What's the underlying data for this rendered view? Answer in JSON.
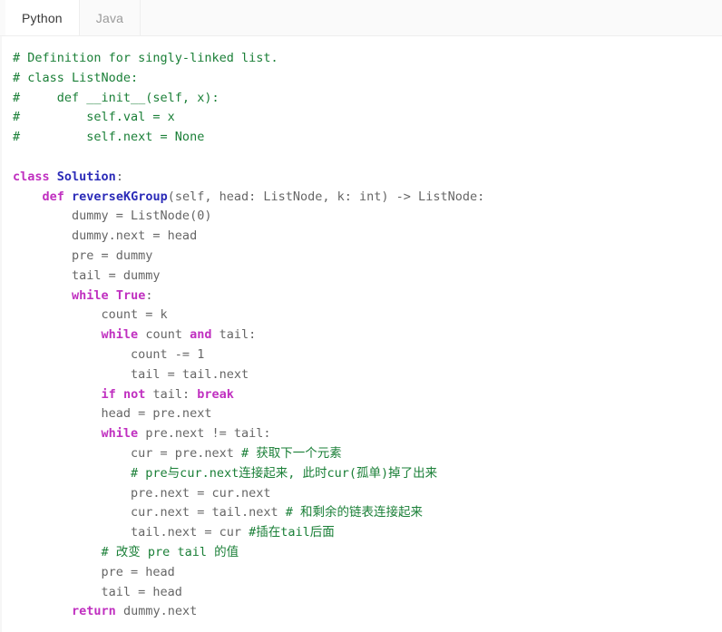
{
  "tabs": [
    {
      "label": "Python",
      "active": true
    },
    {
      "label": "Java",
      "active": false
    }
  ],
  "colors": {
    "comment": "#1a7f37",
    "keyword": "#c030c0",
    "name": "#2b2bb8",
    "plain": "#666666",
    "background": "#ffffff",
    "tabbar_background": "#fafafa",
    "border": "#eeeeee"
  },
  "code": {
    "language": "Python",
    "lines": [
      [
        {
          "t": "comment",
          "s": "# Definition for singly-linked list."
        }
      ],
      [
        {
          "t": "comment",
          "s": "# class ListNode:"
        }
      ],
      [
        {
          "t": "comment",
          "s": "#     def __init__(self, x):"
        }
      ],
      [
        {
          "t": "comment",
          "s": "#         self.val = x"
        }
      ],
      [
        {
          "t": "comment",
          "s": "#         self.next = None"
        }
      ],
      [
        {
          "t": "plain",
          "s": ""
        }
      ],
      [
        {
          "t": "keyword",
          "s": "class"
        },
        {
          "t": "plain",
          "s": " "
        },
        {
          "t": "name",
          "s": "Solution"
        },
        {
          "t": "plain",
          "s": ":"
        }
      ],
      [
        {
          "t": "plain",
          "s": "    "
        },
        {
          "t": "keyword",
          "s": "def"
        },
        {
          "t": "plain",
          "s": " "
        },
        {
          "t": "name",
          "s": "reverseKGroup"
        },
        {
          "t": "plain",
          "s": "(self, head: ListNode, k: int) -> ListNode:"
        }
      ],
      [
        {
          "t": "plain",
          "s": "        dummy = ListNode(0)"
        }
      ],
      [
        {
          "t": "plain",
          "s": "        dummy.next = head"
        }
      ],
      [
        {
          "t": "plain",
          "s": "        pre = dummy"
        }
      ],
      [
        {
          "t": "plain",
          "s": "        tail = dummy"
        }
      ],
      [
        {
          "t": "plain",
          "s": "        "
        },
        {
          "t": "keyword",
          "s": "while"
        },
        {
          "t": "plain",
          "s": " "
        },
        {
          "t": "keyword",
          "s": "True"
        },
        {
          "t": "plain",
          "s": ":"
        }
      ],
      [
        {
          "t": "plain",
          "s": "            count = k"
        }
      ],
      [
        {
          "t": "plain",
          "s": "            "
        },
        {
          "t": "keyword",
          "s": "while"
        },
        {
          "t": "plain",
          "s": " count "
        },
        {
          "t": "keyword",
          "s": "and"
        },
        {
          "t": "plain",
          "s": " tail:"
        }
      ],
      [
        {
          "t": "plain",
          "s": "                count -= 1"
        }
      ],
      [
        {
          "t": "plain",
          "s": "                tail = tail.next"
        }
      ],
      [
        {
          "t": "plain",
          "s": "            "
        },
        {
          "t": "keyword",
          "s": "if"
        },
        {
          "t": "plain",
          "s": " "
        },
        {
          "t": "keyword",
          "s": "not"
        },
        {
          "t": "plain",
          "s": " tail: "
        },
        {
          "t": "keyword",
          "s": "break"
        }
      ],
      [
        {
          "t": "plain",
          "s": "            head = pre.next"
        }
      ],
      [
        {
          "t": "plain",
          "s": "            "
        },
        {
          "t": "keyword",
          "s": "while"
        },
        {
          "t": "plain",
          "s": " pre.next != tail:"
        }
      ],
      [
        {
          "t": "plain",
          "s": "                cur = pre.next "
        },
        {
          "t": "comment",
          "s": "# 获取下一个元素"
        }
      ],
      [
        {
          "t": "plain",
          "s": "                "
        },
        {
          "t": "comment",
          "s": "# pre与cur.next连接起来, 此时cur(孤单)掉了出来"
        }
      ],
      [
        {
          "t": "plain",
          "s": "                pre.next = cur.next"
        }
      ],
      [
        {
          "t": "plain",
          "s": "                cur.next = tail.next "
        },
        {
          "t": "comment",
          "s": "# 和剩余的链表连接起来"
        }
      ],
      [
        {
          "t": "plain",
          "s": "                tail.next = cur "
        },
        {
          "t": "comment",
          "s": "#插在tail后面"
        }
      ],
      [
        {
          "t": "plain",
          "s": "            "
        },
        {
          "t": "comment",
          "s": "# 改变 pre tail 的值"
        }
      ],
      [
        {
          "t": "plain",
          "s": "            pre = head"
        }
      ],
      [
        {
          "t": "plain",
          "s": "            tail = head"
        }
      ],
      [
        {
          "t": "plain",
          "s": "        "
        },
        {
          "t": "keyword",
          "s": "return"
        },
        {
          "t": "plain",
          "s": " dummy.next"
        }
      ]
    ]
  }
}
